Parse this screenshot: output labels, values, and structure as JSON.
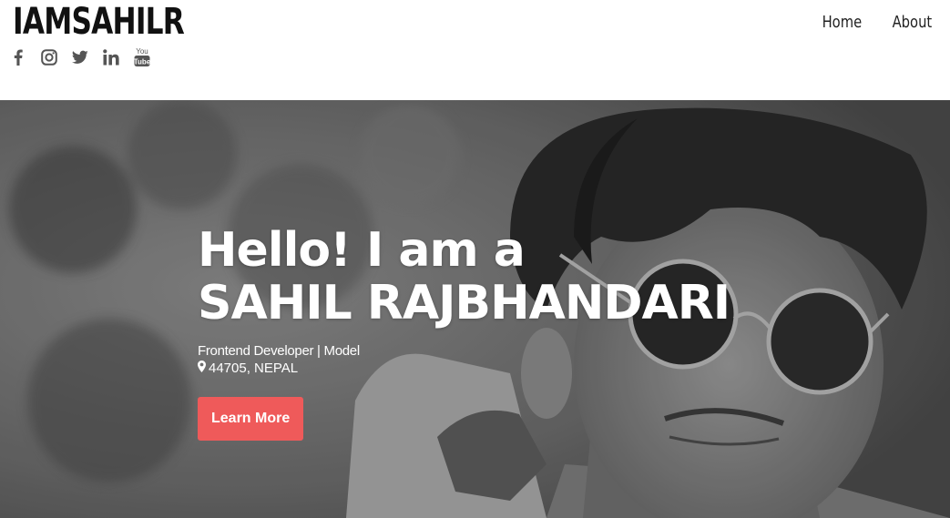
{
  "header": {
    "brand": "IAMSAHILR",
    "nav": {
      "home": "Home",
      "about": "About"
    },
    "socials": [
      "facebook-icon",
      "instagram-icon",
      "twitter-icon",
      "linkedin-icon",
      "youtube-icon"
    ],
    "youtube_label_top": "You",
    "youtube_label_bottom": "Tube"
  },
  "hero": {
    "greeting": "Hello! I am a",
    "name": "SAHIL RAJBHANDARI",
    "role": "Frontend Developer | Model",
    "location": "44705, NEPAL",
    "cta": "Learn More",
    "cta_color": "#ef5a5a"
  }
}
